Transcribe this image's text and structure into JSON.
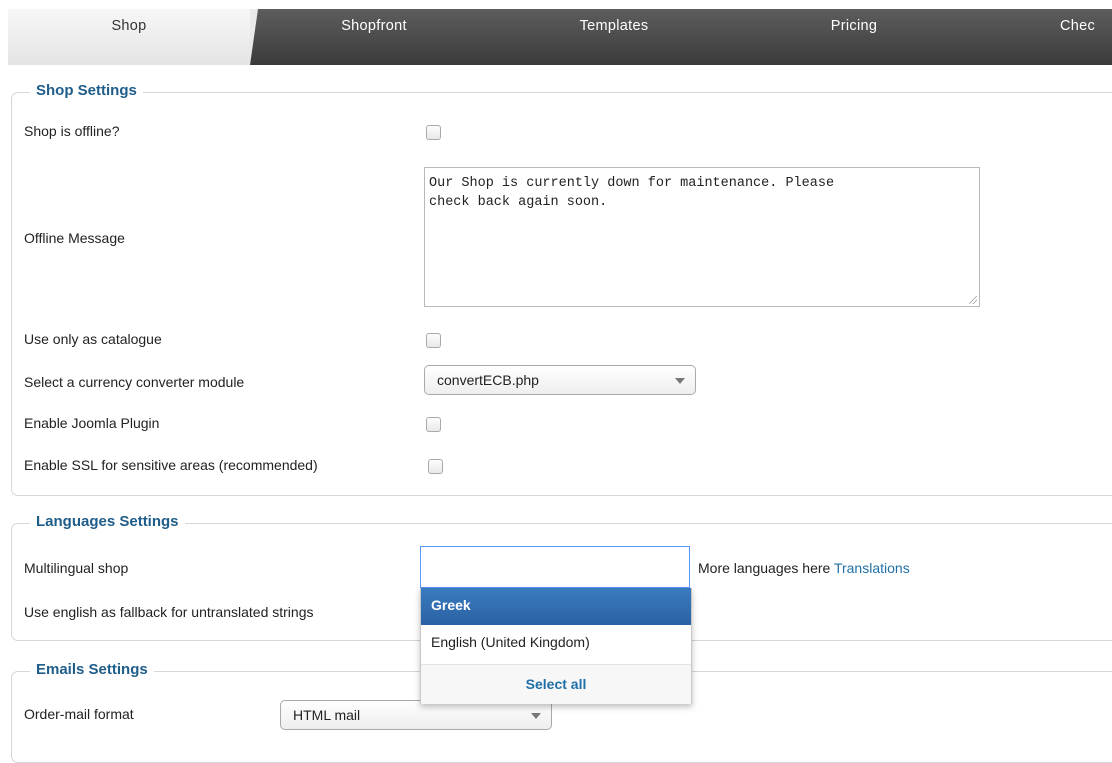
{
  "tabs": [
    {
      "label": "Shop"
    },
    {
      "label": "Shopfront"
    },
    {
      "label": "Templates"
    },
    {
      "label": "Pricing"
    },
    {
      "label": "Chec"
    }
  ],
  "shop_settings": {
    "legend": "Shop Settings",
    "offline_label": "Shop is offline?",
    "offline_checked": false,
    "offline_message_label": "Offline Message",
    "offline_message_value": "Our Shop is currently down for maintenance. Please\ncheck back again soon.",
    "catalogue_label": "Use only as catalogue",
    "catalogue_checked": false,
    "currency_label": "Select a currency converter module",
    "currency_value": "convertECB.php",
    "joomla_label": "Enable Joomla Plugin",
    "joomla_checked": false,
    "ssl_label": "Enable SSL for sensitive areas (recommended)",
    "ssl_checked": false
  },
  "languages_settings": {
    "legend": "Languages Settings",
    "multilingual_label": "Multilingual shop",
    "multilingual_value": "",
    "more_text": "More languages here",
    "translations_link": "Translations",
    "fallback_label": "Use english as fallback for untranslated strings",
    "dropdown_options": [
      "Greek",
      "English (United Kingdom)"
    ],
    "dropdown_highlighted": "Greek",
    "select_all": "Select all"
  },
  "emails_settings": {
    "legend": "Emails Settings",
    "order_mail_label": "Order-mail format",
    "order_mail_value": "HTML mail"
  }
}
